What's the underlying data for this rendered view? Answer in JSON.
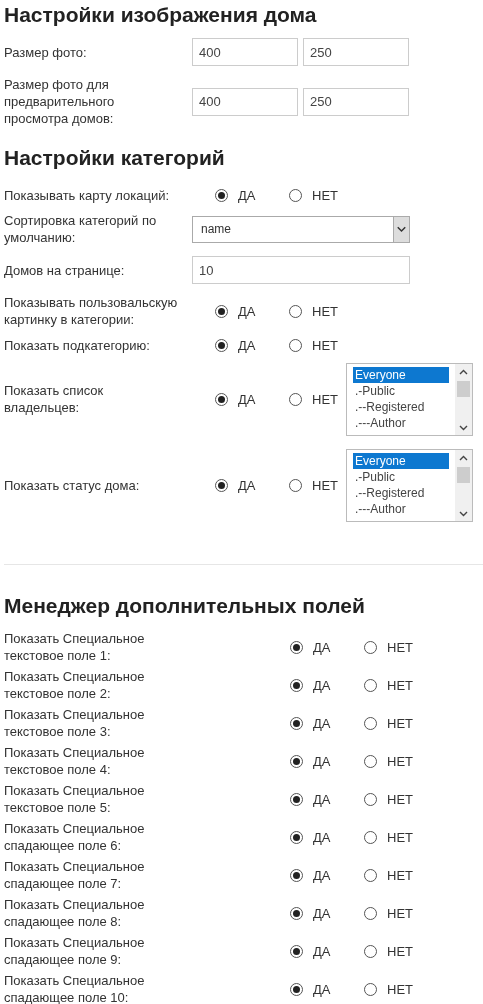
{
  "sections": [
    {
      "title": "Настройки изображения дома",
      "rows": [
        {
          "kind": "text_pair",
          "label": "Размер фото:",
          "values": [
            "400",
            "250"
          ]
        },
        {
          "kind": "text_pair",
          "label": "Размер фото для предварительного просмотра домов:",
          "values": [
            "400",
            "250"
          ]
        }
      ]
    },
    {
      "title": "Настройки категорий",
      "rows": [
        {
          "kind": "radio",
          "label": "Показывать карту локаций:",
          "options": [
            {
              "label": "ДА",
              "selected": true
            },
            {
              "label": "НЕТ",
              "selected": false
            }
          ]
        },
        {
          "kind": "select",
          "label": "Сортировка категорий по умолчанию:",
          "value": "name"
        },
        {
          "kind": "text",
          "label": "Домов на странице:",
          "value": "10"
        },
        {
          "kind": "radio",
          "label": "Показывать пользовальскую картинку в категории:",
          "options": [
            {
              "label": "ДА",
              "selected": true
            },
            {
              "label": "НЕТ",
              "selected": false
            }
          ]
        },
        {
          "kind": "radio",
          "label": "Показать подкатегорию:",
          "options": [
            {
              "label": "ДА",
              "selected": true
            },
            {
              "label": "НЕТ",
              "selected": false
            }
          ]
        },
        {
          "kind": "radio_list",
          "label": "Показать список владельцев:",
          "options": [
            {
              "label": "ДА",
              "selected": true
            },
            {
              "label": "НЕТ",
              "selected": false
            }
          ],
          "list": [
            {
              "label": "Everyone",
              "selected": true
            },
            {
              "label": ".-Public",
              "selected": false
            },
            {
              "label": ".--Registered",
              "selected": false
            },
            {
              "label": ".---Author",
              "selected": false
            }
          ]
        },
        {
          "kind": "radio_list",
          "label": "Показать статус дома:",
          "options": [
            {
              "label": "ДА",
              "selected": true
            },
            {
              "label": "НЕТ",
              "selected": false
            }
          ],
          "list": [
            {
              "label": "Everyone",
              "selected": true
            },
            {
              "label": ".-Public",
              "selected": false
            },
            {
              "label": ".--Registered",
              "selected": false
            },
            {
              "label": ".---Author",
              "selected": false
            }
          ]
        }
      ]
    },
    {
      "title": "Менеджер дополнительных полей",
      "rows": [
        {
          "kind": "radio",
          "label": "Показать Специальное текстовое поле 1:",
          "options": [
            {
              "label": "ДА",
              "selected": true
            },
            {
              "label": "НЕТ",
              "selected": false
            }
          ]
        },
        {
          "kind": "radio",
          "label": "Показать Специальное текстовое поле 2:",
          "options": [
            {
              "label": "ДА",
              "selected": true
            },
            {
              "label": "НЕТ",
              "selected": false
            }
          ]
        },
        {
          "kind": "radio",
          "label": "Показать Специальное текстовое поле 3:",
          "options": [
            {
              "label": "ДА",
              "selected": true
            },
            {
              "label": "НЕТ",
              "selected": false
            }
          ]
        },
        {
          "kind": "radio",
          "label": "Показать Специальное текстовое поле 4:",
          "options": [
            {
              "label": "ДА",
              "selected": true
            },
            {
              "label": "НЕТ",
              "selected": false
            }
          ]
        },
        {
          "kind": "radio",
          "label": "Показать Специальное текстовое поле 5:",
          "options": [
            {
              "label": "ДА",
              "selected": true
            },
            {
              "label": "НЕТ",
              "selected": false
            }
          ]
        },
        {
          "kind": "radio",
          "label": "Показать Специальное спадающее поле 6:",
          "options": [
            {
              "label": "ДА",
              "selected": true
            },
            {
              "label": "НЕТ",
              "selected": false
            }
          ]
        },
        {
          "kind": "radio",
          "label": "Показать Специальное спадающее поле 7:",
          "options": [
            {
              "label": "ДА",
              "selected": true
            },
            {
              "label": "НЕТ",
              "selected": false
            }
          ]
        },
        {
          "kind": "radio",
          "label": "Показать Специальное спадающее поле 8:",
          "options": [
            {
              "label": "ДА",
              "selected": true
            },
            {
              "label": "НЕТ",
              "selected": false
            }
          ]
        },
        {
          "kind": "radio",
          "label": "Показать Специальное спадающее поле 9:",
          "options": [
            {
              "label": "ДА",
              "selected": true
            },
            {
              "label": "НЕТ",
              "selected": false
            }
          ]
        },
        {
          "kind": "radio",
          "label": "Показать Специальное спадающее поле 10:",
          "options": [
            {
              "label": "ДА",
              "selected": true
            },
            {
              "label": "НЕТ",
              "selected": false
            }
          ]
        }
      ]
    }
  ]
}
